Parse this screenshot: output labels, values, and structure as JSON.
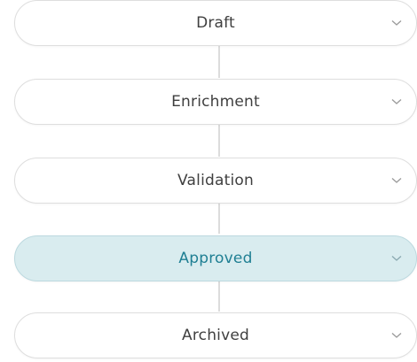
{
  "workflow": {
    "stages": [
      {
        "label": "Draft",
        "active": false
      },
      {
        "label": "Enrichment",
        "active": false
      },
      {
        "label": "Validation",
        "active": false
      },
      {
        "label": "Approved",
        "active": true
      },
      {
        "label": "Archived",
        "active": false
      }
    ],
    "colors": {
      "active_background": "#d9ecef",
      "active_text": "#1f7f93",
      "border": "#dedede",
      "connector": "#dcdcdc"
    },
    "expand_icon": "chevron-down-icon"
  }
}
